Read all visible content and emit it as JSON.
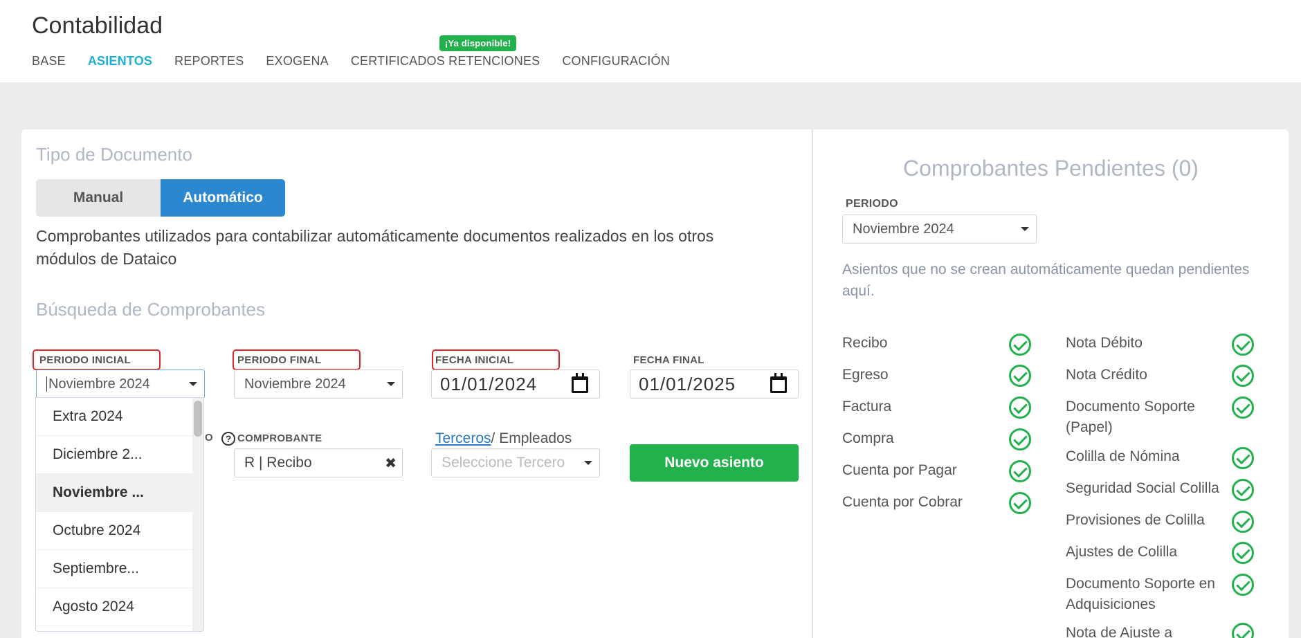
{
  "app": {
    "title": "Contabilidad"
  },
  "nav": {
    "tabs": [
      {
        "label": "BASE"
      },
      {
        "label": "ASIENTOS"
      },
      {
        "label": "REPORTES"
      },
      {
        "label": "EXOGENA"
      },
      {
        "label": "CERTIFICADOS RETENCIONES"
      },
      {
        "label": "CONFIGURACIÓN"
      }
    ],
    "badge": "¡Ya disponible!"
  },
  "left": {
    "doc_type_title": "Tipo de Documento",
    "toggle": {
      "manual": "Manual",
      "auto": "Automático"
    },
    "description": "Comprobantes utilizados para contabilizar automáticamente documentos realizados en los otros módulos de Dataico",
    "search_title": "Búsqueda de Comprobantes",
    "labels": {
      "periodo_inicial": "PERIODO INICIAL",
      "periodo_final": "PERIODO FINAL",
      "fecha_inicial": "FECHA INICIAL",
      "fecha_final": "FECHA FINAL",
      "partial_o": "O",
      "comprobante": "COMPROBANTE",
      "help": "?"
    },
    "periodo_inicial_value": "Noviembre 2024",
    "periodo_final_value": "Noviembre 2024",
    "fecha_inicial_value": "01/01/2024",
    "fecha_final_value": "01/01/2025",
    "dropdown_options": [
      "Extra 2024",
      "Diciembre 2...",
      "Noviembre ...",
      "Octubre 2024",
      "Septiembre...",
      "Agosto 2024"
    ],
    "comprobante_value": "R | Recibo",
    "clear_icon": "✖",
    "terceros_link": "Terceros",
    "empleados_text": "/ Empleados",
    "tercero_placeholder": "Seleccione Tercero",
    "new_button": "Nuevo asiento"
  },
  "right": {
    "title": "Comprobantes Pendientes (0)",
    "periodo_label": "PERIODO",
    "periodo_value": "Noviembre 2024",
    "note": "Asientos que no se crean automáticamente quedan pendientes aquí.",
    "col1": [
      "Recibo",
      "Egreso",
      "Factura",
      "Compra",
      "Cuenta por Pagar",
      "Cuenta por Cobrar"
    ],
    "col2": [
      "Nota Débito",
      "Nota Crédito",
      "Documento Soporte (Papel)",
      "Colilla de Nómina",
      "Seguridad Social Colilla",
      "Provisiones de Colilla",
      "Ajustes de Colilla",
      "Documento Soporte en Adquisiciones",
      "Nota de Ajuste a"
    ]
  },
  "colors": {
    "accent": "#1ab0d8",
    "primary_blue": "#2a87d0",
    "success_green": "#23b14d",
    "highlight_red": "#e0242c"
  }
}
